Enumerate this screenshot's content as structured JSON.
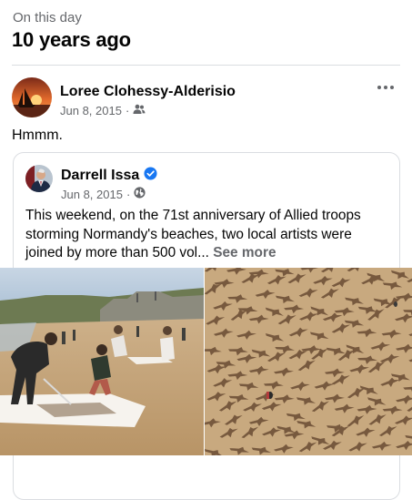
{
  "section": {
    "subtitle": "On this day",
    "title": "10 years ago"
  },
  "post": {
    "author": "Loree Clohessy-Alderisio",
    "date": "Jun 8, 2015",
    "separator": "·",
    "audience_icon": "friends-icon",
    "text": "Hmmm.",
    "more_icon": "more-options-icon"
  },
  "shared_post": {
    "author": "Darrell Issa",
    "verified_icon": "verified-badge-icon",
    "date": "Jun 8, 2015",
    "separator": "·",
    "audience_icon": "globe-icon",
    "text": "This weekend, on the 71st anniversary of Allied troops storming Normandy's beaches, two local artists were joined by more than 500 vol...",
    "see_more": "See more"
  },
  "colors": {
    "secondary_text": "#65676b",
    "verified": "#1877f2",
    "sand": "#c9ab80"
  }
}
